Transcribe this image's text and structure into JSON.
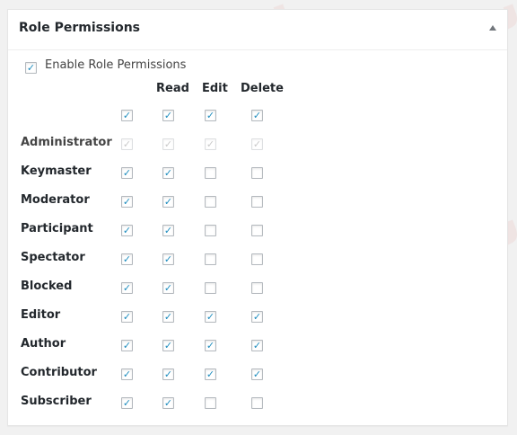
{
  "metabox": {
    "title": "Role Permissions",
    "enable_label": "Enable Role Permissions",
    "enable_checked": true
  },
  "columns": [
    "Read",
    "Edit",
    "Delete"
  ],
  "all_row": {
    "select": true,
    "read": true,
    "edit": true,
    "delete": true
  },
  "roles": [
    {
      "name": "Administrator",
      "select": true,
      "read": true,
      "edit": true,
      "delete": true,
      "disabled": true
    },
    {
      "name": "Keymaster",
      "select": true,
      "read": true,
      "edit": false,
      "delete": false,
      "disabled": false
    },
    {
      "name": "Moderator",
      "select": true,
      "read": true,
      "edit": false,
      "delete": false,
      "disabled": false
    },
    {
      "name": "Participant",
      "select": true,
      "read": true,
      "edit": false,
      "delete": false,
      "disabled": false
    },
    {
      "name": "Spectator",
      "select": true,
      "read": true,
      "edit": false,
      "delete": false,
      "disabled": false
    },
    {
      "name": "Blocked",
      "select": true,
      "read": true,
      "edit": false,
      "delete": false,
      "disabled": false
    },
    {
      "name": "Editor",
      "select": true,
      "read": true,
      "edit": true,
      "delete": true,
      "disabled": false
    },
    {
      "name": "Author",
      "select": true,
      "read": true,
      "edit": true,
      "delete": true,
      "disabled": false
    },
    {
      "name": "Contributor",
      "select": true,
      "read": true,
      "edit": true,
      "delete": true,
      "disabled": false
    },
    {
      "name": "Subscriber",
      "select": true,
      "read": true,
      "edit": false,
      "delete": false,
      "disabled": false
    }
  ],
  "colors": {
    "check": "#1e8cbe",
    "border": "#b4b9be",
    "watermark": "#d9534f"
  }
}
